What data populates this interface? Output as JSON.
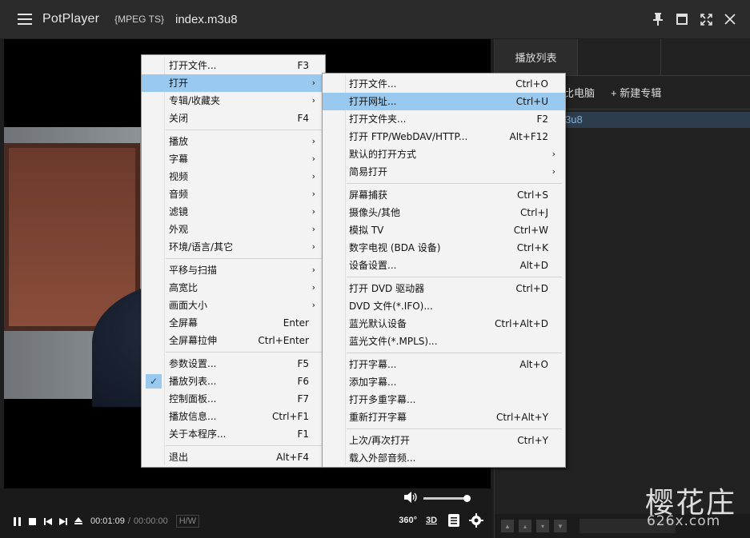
{
  "titlebar": {
    "app_title": "PotPlayer",
    "codec": "{MPEG TS}",
    "file_name": "index.m3u8",
    "controls": [
      "pin-icon",
      "maximize-icon",
      "fullscreen-icon",
      "close-icon"
    ]
  },
  "playback": {
    "current_time": "00:01:09",
    "separator": "/",
    "total_time": "00:00:00",
    "hw_label": "H/W",
    "btn_360": "360°",
    "btn_3d": "3D",
    "volume_level": 0.95
  },
  "playlist": {
    "tabs": [
      "播放列表",
      "",
      ""
    ],
    "subtabs": [
      "比电脑",
      "+ 新建专辑"
    ],
    "item": "3u8"
  },
  "watermark": {
    "line1": "樱花庄",
    "line2": "626x.com"
  },
  "main_menu": {
    "items": [
      {
        "label": "打开文件...",
        "shortcut": "F3",
        "submenu": false
      },
      {
        "label": "打开",
        "shortcut": "",
        "submenu": true,
        "highlighted": true
      },
      {
        "label": "专辑/收藏夹",
        "shortcut": "",
        "submenu": true
      },
      {
        "label": "关闭",
        "shortcut": "F4",
        "submenu": false
      },
      {
        "sep": true
      },
      {
        "label": "播放",
        "shortcut": "",
        "submenu": true
      },
      {
        "label": "字幕",
        "shortcut": "",
        "submenu": true
      },
      {
        "label": "视频",
        "shortcut": "",
        "submenu": true
      },
      {
        "label": "音频",
        "shortcut": "",
        "submenu": true
      },
      {
        "label": "滤镜",
        "shortcut": "",
        "submenu": true
      },
      {
        "label": "外观",
        "shortcut": "",
        "submenu": true
      },
      {
        "label": "环境/语言/其它",
        "shortcut": "",
        "submenu": true
      },
      {
        "sep": true
      },
      {
        "label": "平移与扫描",
        "shortcut": "",
        "submenu": true
      },
      {
        "label": "高宽比",
        "shortcut": "",
        "submenu": true
      },
      {
        "label": "画面大小",
        "shortcut": "",
        "submenu": true
      },
      {
        "label": "全屏幕",
        "shortcut": "Enter",
        "submenu": false
      },
      {
        "label": "全屏幕拉伸",
        "shortcut": "Ctrl+Enter",
        "submenu": false
      },
      {
        "sep": true
      },
      {
        "label": "参数设置...",
        "shortcut": "F5",
        "submenu": false
      },
      {
        "label": "播放列表...",
        "shortcut": "F6",
        "submenu": false,
        "checked": true
      },
      {
        "label": "控制面板...",
        "shortcut": "F7",
        "submenu": false
      },
      {
        "label": "播放信息...",
        "shortcut": "Ctrl+F1",
        "submenu": false
      },
      {
        "label": "关于本程序...",
        "shortcut": "F1",
        "submenu": false
      },
      {
        "sep": true
      },
      {
        "label": "退出",
        "shortcut": "Alt+F4",
        "submenu": false
      }
    ]
  },
  "open_submenu": {
    "items": [
      {
        "label": "打开文件...",
        "shortcut": "Ctrl+O",
        "submenu": false
      },
      {
        "label": "打开网址...",
        "shortcut": "Ctrl+U",
        "submenu": false,
        "highlighted": true
      },
      {
        "label": "打开文件夹...",
        "shortcut": "F2",
        "submenu": false
      },
      {
        "label": "打开 FTP/WebDAV/HTTP...",
        "shortcut": "Alt+F12",
        "submenu": false
      },
      {
        "label": "默认的打开方式",
        "shortcut": "",
        "submenu": true
      },
      {
        "label": "简易打开",
        "shortcut": "",
        "submenu": true
      },
      {
        "sep": true
      },
      {
        "label": "屏幕捕获",
        "shortcut": "Ctrl+S",
        "submenu": false
      },
      {
        "label": "摄像头/其他",
        "shortcut": "Ctrl+J",
        "submenu": false
      },
      {
        "label": "模拟 TV",
        "shortcut": "Ctrl+W",
        "submenu": false
      },
      {
        "label": "数字电视 (BDA 设备)",
        "shortcut": "Ctrl+K",
        "submenu": false
      },
      {
        "label": "设备设置...",
        "shortcut": "Alt+D",
        "submenu": false
      },
      {
        "sep": true
      },
      {
        "label": "打开 DVD 驱动器",
        "shortcut": "Ctrl+D",
        "submenu": false
      },
      {
        "label": "DVD 文件(*.IFO)...",
        "shortcut": "",
        "submenu": false
      },
      {
        "label": "蓝光默认设备",
        "shortcut": "Ctrl+Alt+D",
        "submenu": false
      },
      {
        "label": "蓝光文件(*.MPLS)...",
        "shortcut": "",
        "submenu": false
      },
      {
        "sep": true
      },
      {
        "label": "打开字幕...",
        "shortcut": "Alt+O",
        "submenu": false
      },
      {
        "label": "添加字幕...",
        "shortcut": "",
        "submenu": false
      },
      {
        "label": "打开多重字幕...",
        "shortcut": "",
        "submenu": false
      },
      {
        "label": "重新打开字幕",
        "shortcut": "Ctrl+Alt+Y",
        "submenu": false
      },
      {
        "sep": true
      },
      {
        "label": "上次/再次打开",
        "shortcut": "Ctrl+Y",
        "submenu": false
      },
      {
        "label": "载入外部音频...",
        "shortcut": "",
        "submenu": false
      }
    ]
  }
}
